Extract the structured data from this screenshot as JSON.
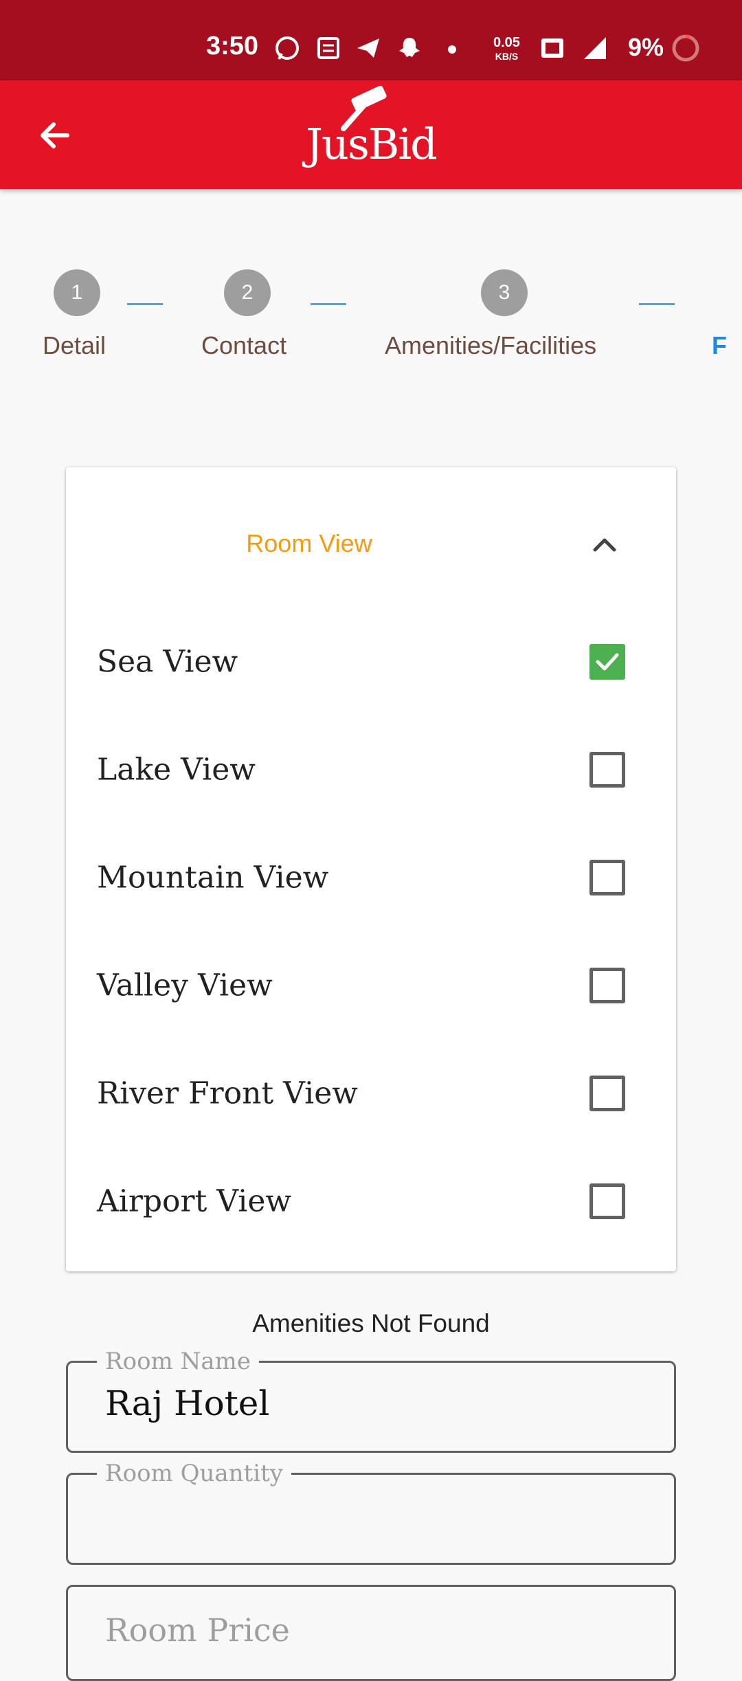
{
  "status_bar": {
    "time": "3:50",
    "net_speed": "0.05",
    "net_unit": "KB/S",
    "battery": "9%",
    "icons": [
      "whatsapp-icon",
      "news-icon",
      "telegram-icon",
      "snapchat-icon",
      "dot-icon",
      "volte-icon",
      "signal-4g-icon",
      "battery-ring-icon"
    ]
  },
  "app_bar": {
    "logo_text": "JusBid",
    "back_icon": "arrow-left-icon",
    "color": "#e21426"
  },
  "stepper": {
    "steps": [
      {
        "number": "1",
        "label": "Detail"
      },
      {
        "number": "2",
        "label": "Contact"
      },
      {
        "number": "3",
        "label": "Amenities/Facilities"
      }
    ],
    "next_partial_label": "F",
    "connector_color": "#4aa3df"
  },
  "room_view": {
    "title": "Room View",
    "expanded": true,
    "options": [
      {
        "label": "Sea View",
        "checked": true
      },
      {
        "label": "Lake View",
        "checked": false
      },
      {
        "label": "Mountain View",
        "checked": false
      },
      {
        "label": "Valley View",
        "checked": false
      },
      {
        "label": "River Front View",
        "checked": false
      },
      {
        "label": "Airport View",
        "checked": false
      }
    ]
  },
  "amenities_message": "Amenities Not Found",
  "form": {
    "room_name": {
      "label": "Room Name",
      "value": "Raj Hotel"
    },
    "room_quantity": {
      "label": "Room Quantity",
      "value": ""
    },
    "room_price": {
      "placeholder": "Room Price"
    }
  },
  "colors": {
    "status_bar": "#a50e1e",
    "accent_orange": "#f39c12",
    "checkbox_checked": "#4caf50"
  }
}
